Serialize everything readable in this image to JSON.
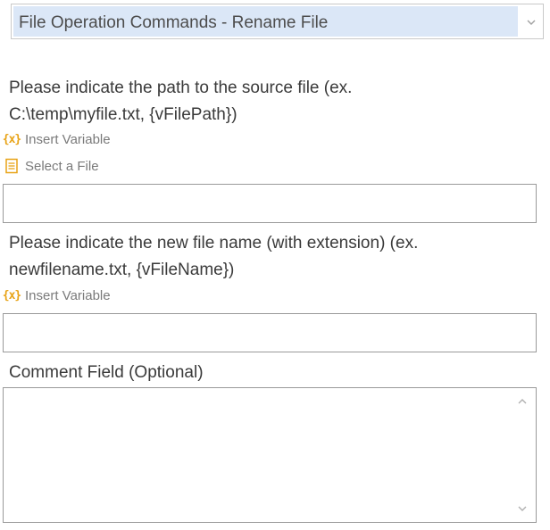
{
  "command_select": {
    "selected": "File Operation Commands - Rename File"
  },
  "source_file": {
    "label_line1": "Please indicate the path to the source file (ex.",
    "label_line2": "C:\\temp\\myfile.txt, {vFilePath})",
    "insert_variable": "Insert Variable",
    "select_file": "Select a File",
    "value": ""
  },
  "new_name": {
    "label_line1": "Please indicate the new file name (with extension) (ex.",
    "label_line2": "newfilename.txt, {vFileName})",
    "insert_variable": "Insert Variable",
    "value": ""
  },
  "comment": {
    "label": "Comment Field (Optional)",
    "value": ""
  },
  "icons": {
    "variable": "insert-variable-icon",
    "file": "select-file-icon",
    "dropdown": "chevron-down-icon",
    "scroll_up": "chevron-up-icon",
    "scroll_down": "chevron-down-icon"
  },
  "colors": {
    "accent_orange": "#e8a317",
    "selection_fill": "#dbe7f7",
    "border": "#9a9a9a"
  }
}
